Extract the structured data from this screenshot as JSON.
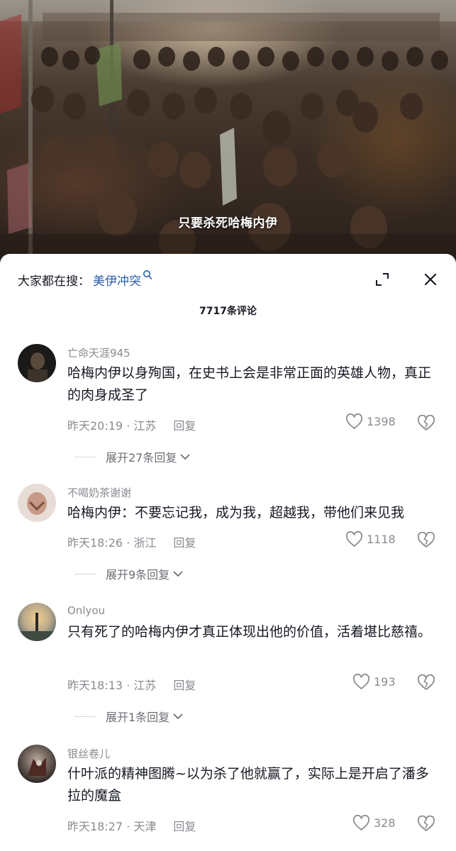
{
  "video": {
    "caption": "只要杀死哈梅内伊"
  },
  "comments_panel": {
    "search_prefix": "大家都在搜：",
    "search_term": "美伊冲突",
    "comment_count": "7717条评论",
    "comments": [
      {
        "username": "亡命天涯945",
        "text": "哈梅内伊以身殉国，在史书上会是非常正面的英雄人物，真正的肉身成圣了",
        "time_location": "昨天20:19 · 江苏",
        "reply_label": "回复",
        "likes": "1398",
        "expand_label": "展开27条回复"
      },
      {
        "username": "不喝奶茶谢谢",
        "text": "哈梅内伊：不要忘记我，成为我，超越我，带他们来见我",
        "time_location": "昨天18:26 · 浙江",
        "reply_label": "回复",
        "likes": "1118",
        "expand_label": "展开9条回复"
      },
      {
        "username": "Onlyou",
        "text": "只有死了的哈梅内伊才真正体现出他的价值，活着堪比慈禧。",
        "time_location": "昨天18:13 · 江苏",
        "reply_label": "回复",
        "likes": "193",
        "expand_label": "展开1条回复"
      },
      {
        "username": "银丝卷儿",
        "text": "什叶派的精神图腾~以为杀了他就赢了，实际上是开启了潘多拉的魔盒",
        "time_location": "昨天18:27 · 天津",
        "reply_label": "回复",
        "likes": "328"
      }
    ]
  },
  "icons": [
    "search-icon",
    "expand-icon",
    "close-icon",
    "heart-icon",
    "broken-heart-icon",
    "chevron-down-icon"
  ],
  "colors": {
    "search_term": "#2b5ca8",
    "secondary_text": "#8a8b91",
    "primary_text": "#161823"
  }
}
